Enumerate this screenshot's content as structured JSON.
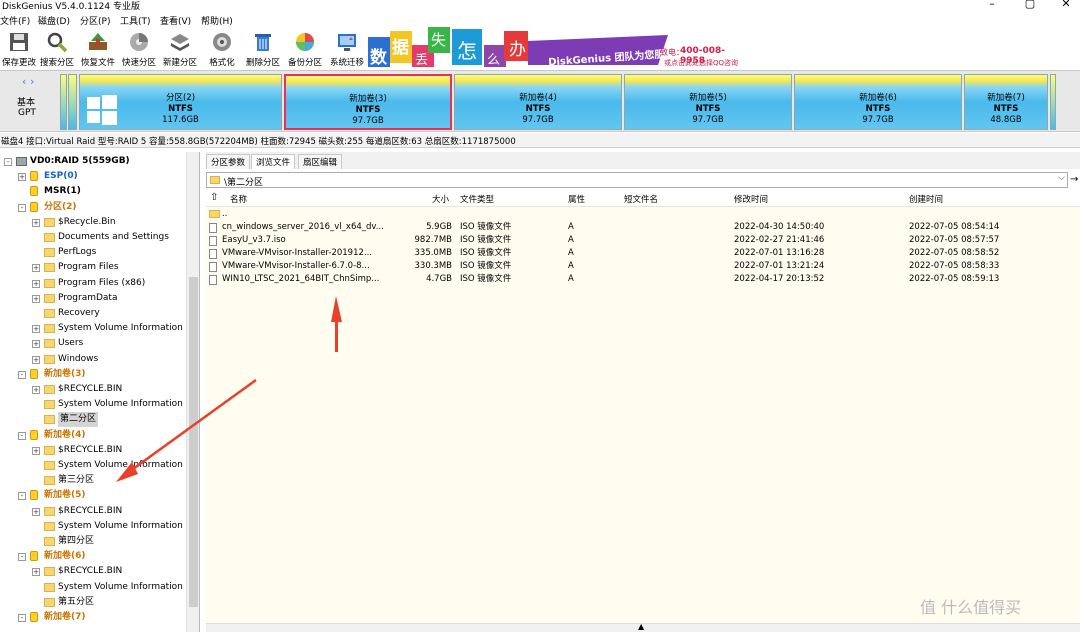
{
  "window": {
    "title": "DiskGenius V5.4.0.1124 专业版"
  },
  "menu": [
    "文件(F)",
    "磁盘(D)",
    "分区(P)",
    "工具(T)",
    "查看(V)",
    "帮助(H)"
  ],
  "toolbar": [
    {
      "label": "保存更改",
      "icon": "save-icon"
    },
    {
      "label": "搜索分区",
      "icon": "search-icon"
    },
    {
      "label": "恢复文件",
      "icon": "recover-icon"
    },
    {
      "label": "快速分区",
      "icon": "quick-partition-icon"
    },
    {
      "label": "新建分区",
      "icon": "new-partition-icon"
    },
    {
      "label": "格式化",
      "icon": "format-icon"
    },
    {
      "label": "删除分区",
      "icon": "delete-icon"
    },
    {
      "label": "备份分区",
      "icon": "backup-icon"
    },
    {
      "label": "系统迁移",
      "icon": "migrate-icon"
    }
  ],
  "banner": {
    "chars": [
      "数",
      "据",
      "丢",
      "失",
      "怎",
      "么",
      "办"
    ],
    "slogan": "DiskGenius 团队为您服务",
    "phone_label": "致电：",
    "phone": "400-008-9958",
    "qq": "或点击此处选择QQ咨询"
  },
  "disk_nav": {
    "line1": "基本",
    "line2": "GPT"
  },
  "partitions": [
    {
      "name": "分区(2)",
      "fs": "NTFS",
      "size": "117.6GB",
      "selected": false
    },
    {
      "name": "新加卷(3)",
      "fs": "NTFS",
      "size": "97.7GB",
      "selected": true
    },
    {
      "name": "新加卷(4)",
      "fs": "NTFS",
      "size": "97.7GB",
      "selected": false
    },
    {
      "name": "新加卷(5)",
      "fs": "NTFS",
      "size": "97.7GB",
      "selected": false
    },
    {
      "name": "新加卷(6)",
      "fs": "NTFS",
      "size": "97.7GB",
      "selected": false
    },
    {
      "name": "新加卷(7)",
      "fs": "NTFS",
      "size": "48.8GB",
      "selected": false
    }
  ],
  "diskinfo": "磁盘4 接口:Virtual Raid  型号:RAID 5  容量:558.8GB(572204MB)  柱面数:72945  磁头数:255  每道扇区数:63  总扇区数:1171875000",
  "tree": [
    {
      "label": "VD0:RAID 5(559GB)",
      "level": 0,
      "style": "bold",
      "exp": "⊟"
    },
    {
      "label": "ESP(0)",
      "level": 1,
      "style": "blue",
      "exp": "+"
    },
    {
      "label": "MSR(1)",
      "level": 1,
      "style": "bold",
      "exp": ""
    },
    {
      "label": "分区(2)",
      "level": 1,
      "style": "orange",
      "exp": "-"
    },
    {
      "label": "$Recycle.Bin",
      "level": 2,
      "style": "",
      "exp": "+"
    },
    {
      "label": "Documents and Settings",
      "level": 2,
      "style": "",
      "exp": ""
    },
    {
      "label": "PerfLogs",
      "level": 2,
      "style": "",
      "exp": ""
    },
    {
      "label": "Program Files",
      "level": 2,
      "style": "",
      "exp": "+"
    },
    {
      "label": "Program Files (x86)",
      "level": 2,
      "style": "",
      "exp": "+"
    },
    {
      "label": "ProgramData",
      "level": 2,
      "style": "",
      "exp": "+"
    },
    {
      "label": "Recovery",
      "level": 2,
      "style": "",
      "exp": ""
    },
    {
      "label": "System Volume Information",
      "level": 2,
      "style": "",
      "exp": "+"
    },
    {
      "label": "Users",
      "level": 2,
      "style": "",
      "exp": "+"
    },
    {
      "label": "Windows",
      "level": 2,
      "style": "",
      "exp": "+"
    },
    {
      "label": "新加卷(3)",
      "level": 1,
      "style": "orange",
      "exp": "-"
    },
    {
      "label": "$RECYCLE.BIN",
      "level": 2,
      "style": "",
      "exp": "+"
    },
    {
      "label": "System Volume Information",
      "level": 2,
      "style": "",
      "exp": ""
    },
    {
      "label": "第二分区",
      "level": 2,
      "style": "sel",
      "exp": ""
    },
    {
      "label": "新加卷(4)",
      "level": 1,
      "style": "orange",
      "exp": "-"
    },
    {
      "label": "$RECYCLE.BIN",
      "level": 2,
      "style": "",
      "exp": "+"
    },
    {
      "label": "System Volume Information",
      "level": 2,
      "style": "",
      "exp": ""
    },
    {
      "label": "第三分区",
      "level": 2,
      "style": "",
      "exp": ""
    },
    {
      "label": "新加卷(5)",
      "level": 1,
      "style": "orange",
      "exp": "-"
    },
    {
      "label": "$RECYCLE.BIN",
      "level": 2,
      "style": "",
      "exp": "+"
    },
    {
      "label": "System Volume Information",
      "level": 2,
      "style": "",
      "exp": ""
    },
    {
      "label": "第四分区",
      "level": 2,
      "style": "",
      "exp": ""
    },
    {
      "label": "新加卷(6)",
      "level": 1,
      "style": "orange",
      "exp": "-"
    },
    {
      "label": "$RECYCLE.BIN",
      "level": 2,
      "style": "",
      "exp": "+"
    },
    {
      "label": "System Volume Information",
      "level": 2,
      "style": "",
      "exp": ""
    },
    {
      "label": "第五分区",
      "level": 2,
      "style": "",
      "exp": ""
    },
    {
      "label": "新加卷(7)",
      "level": 1,
      "style": "orange",
      "exp": "-"
    }
  ],
  "tabs": [
    "分区参数",
    "浏览文件",
    "扇区编辑"
  ],
  "path": "\\第二分区",
  "columns": {
    "name": "名称",
    "size": "大小",
    "type": "文件类型",
    "attr": "属性",
    "short": "短文件名",
    "modified": "修改时间",
    "created": "创建时间"
  },
  "files": [
    {
      "name": "..",
      "size": "",
      "type": "",
      "attr": "",
      "modified": "",
      "created": ""
    },
    {
      "name": "cn_windows_server_2016_vl_x64_dv...",
      "size": "5.9GB",
      "type": "ISO 镜像文件",
      "attr": "A",
      "modified": "2022-04-30 14:50:40",
      "created": "2022-07-05 08:54:14"
    },
    {
      "name": "EasyU_v3.7.iso",
      "size": "982.7MB",
      "type": "ISO 镜像文件",
      "attr": "A",
      "modified": "2022-02-27 21:41:46",
      "created": "2022-07-05 08:57:57"
    },
    {
      "name": "VMware-VMvisor-Installer-201912...",
      "size": "335.0MB",
      "type": "ISO 镜像文件",
      "attr": "A",
      "modified": "2022-07-01 13:16:28",
      "created": "2022-07-05 08:58:52"
    },
    {
      "name": "VMware-VMvisor-Installer-6.7.0-8...",
      "size": "330.3MB",
      "type": "ISO 镜像文件",
      "attr": "A",
      "modified": "2022-07-01 13:21:24",
      "created": "2022-07-05 08:58:33"
    },
    {
      "name": "WIN10_LTSC_2021_64BIT_ChnSimp...",
      "size": "4.7GB",
      "type": "ISO 镜像文件",
      "attr": "A",
      "modified": "2022-04-17 20:13:52",
      "created": "2022-07-05 08:59:13"
    }
  ],
  "watermark": "值 什么值得买"
}
